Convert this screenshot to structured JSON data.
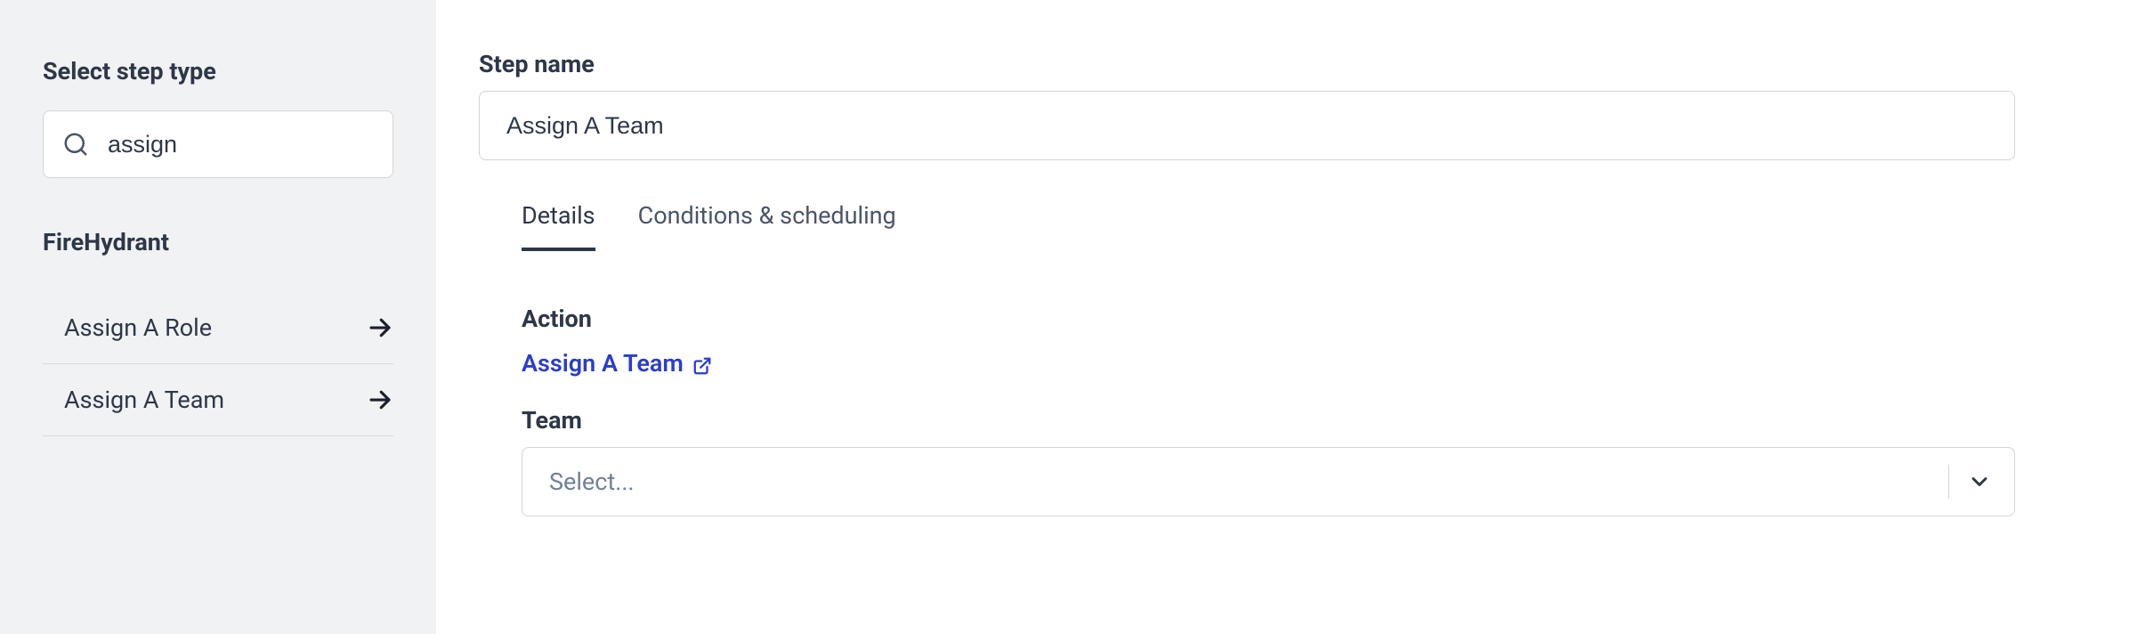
{
  "sidebar": {
    "title": "Select step type",
    "search_value": "assign",
    "group_title": "FireHydrant",
    "items": [
      {
        "label": "Assign A Role"
      },
      {
        "label": "Assign A Team"
      }
    ]
  },
  "main": {
    "step_name_label": "Step name",
    "step_name_value": "Assign A Team",
    "tabs": [
      {
        "label": "Details",
        "active": true
      },
      {
        "label": "Conditions & scheduling",
        "active": false
      }
    ],
    "action_label": "Action",
    "action_link": "Assign A Team",
    "team_label": "Team",
    "team_placeholder": "Select..."
  }
}
